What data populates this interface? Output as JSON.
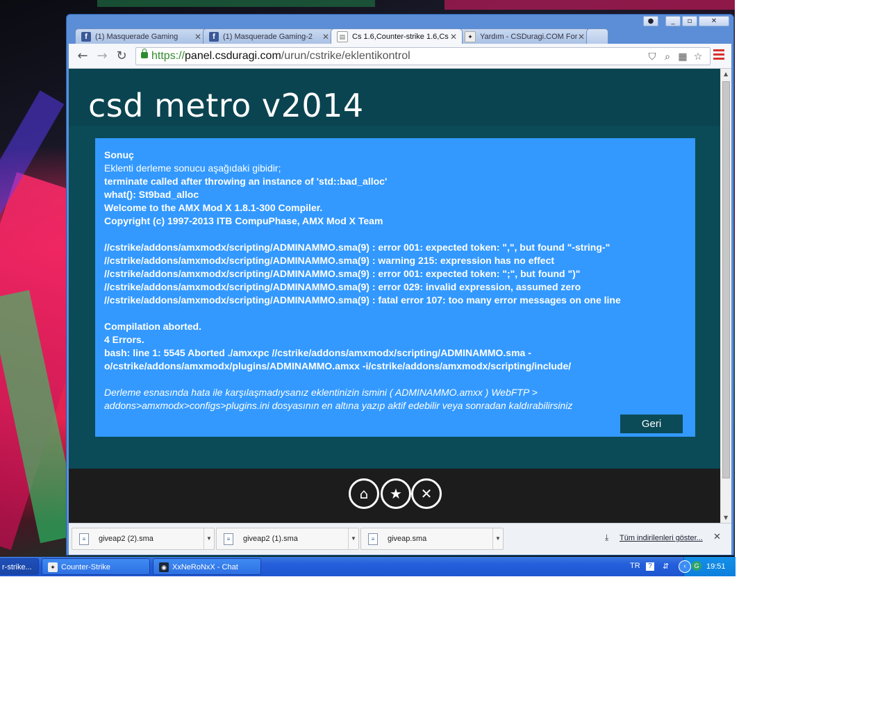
{
  "browser": {
    "tabs": [
      {
        "title": "(1) Masquerade Gaming",
        "icon": "facebook-icon",
        "active": false
      },
      {
        "title": "(1) Masquerade Gaming-2",
        "icon": "facebook-icon",
        "active": false
      },
      {
        "title": "Cs 1.6,Counter-strike 1.6,Cs",
        "icon": "page-icon",
        "active": true
      },
      {
        "title": "Yardım - CSDuragi.COM Forum",
        "icon": "counter-strike-icon",
        "active": false
      }
    ],
    "url": {
      "scheme": "https://",
      "domain": "panel.csduragi.com",
      "path": "/urun/cstrike/eklentikontrol"
    },
    "nav": {
      "back": "←",
      "forward": "→",
      "reload": "↻"
    }
  },
  "page": {
    "site_title": "csd metro v2014",
    "result": {
      "heading": "Sonuç",
      "intro": "Eklenti derleme sonucu aşağıdaki gibidir;",
      "lines_a": [
        "terminate called after throwing an instance of 'std::bad_alloc'",
        "what(): St9bad_alloc",
        "Welcome to the AMX Mod X 1.8.1-300 Compiler.",
        "Copyright (c) 1997-2013 ITB CompuPhase, AMX Mod X Team"
      ],
      "lines_b": [
        "//cstrike/addons/amxmodx/scripting/ADMINAMMO.sma(9) : error 001: expected token: \",\", but found \"-string-\"",
        "//cstrike/addons/amxmodx/scripting/ADMINAMMO.sma(9) : warning 215: expression has no effect",
        "//cstrike/addons/amxmodx/scripting/ADMINAMMO.sma(9) : error 001: expected token: \";\", but found \")\"",
        "//cstrike/addons/amxmodx/scripting/ADMINAMMO.sma(9) : error 029: invalid expression, assumed zero",
        "//cstrike/addons/amxmodx/scripting/ADMINAMMO.sma(9) : fatal error 107: too many error messages on one line"
      ],
      "lines_c": [
        "Compilation aborted.",
        "4 Errors.",
        "bash: line 1: 5545 Aborted ./amxxpc //cstrike/addons/amxmodx/scripting/ADMINAMMO.sma -",
        "o/cstrike/addons/amxmodx/plugins/ADMINAMMO.amxx -i/cstrike/addons/amxmodx/scripting/include/"
      ],
      "note_1": "Derleme esnasında hata ile karşılaşmadıysanız eklentinizin ismini ( ADMINAMMO.amxx ) WebFTP >",
      "note_2": "addons>amxmodx>configs>plugins.ini dosyasının en altına yazıp aktif edebilir veya sonradan kaldırabilirsiniz",
      "back_button": "Geri"
    },
    "footer_icons": [
      "home-icon",
      "star-icon",
      "close-icon"
    ]
  },
  "downloads": {
    "items": [
      "giveap2 (2).sma",
      "giveap2 (1).sma",
      "giveap.sma"
    ],
    "show_all": "Tüm indirilenleri göster..."
  },
  "taskbar": {
    "tasks": [
      "r-strike...",
      "Counter-Strike",
      "XxNeRoNxX - Chat"
    ],
    "language": "TR",
    "clock": "19:51"
  },
  "colors": {
    "page_bg": "#0b4a57",
    "panel_bg": "#3399ff",
    "footer_bg": "#1c1c1c",
    "taskbar": "#245edb"
  }
}
